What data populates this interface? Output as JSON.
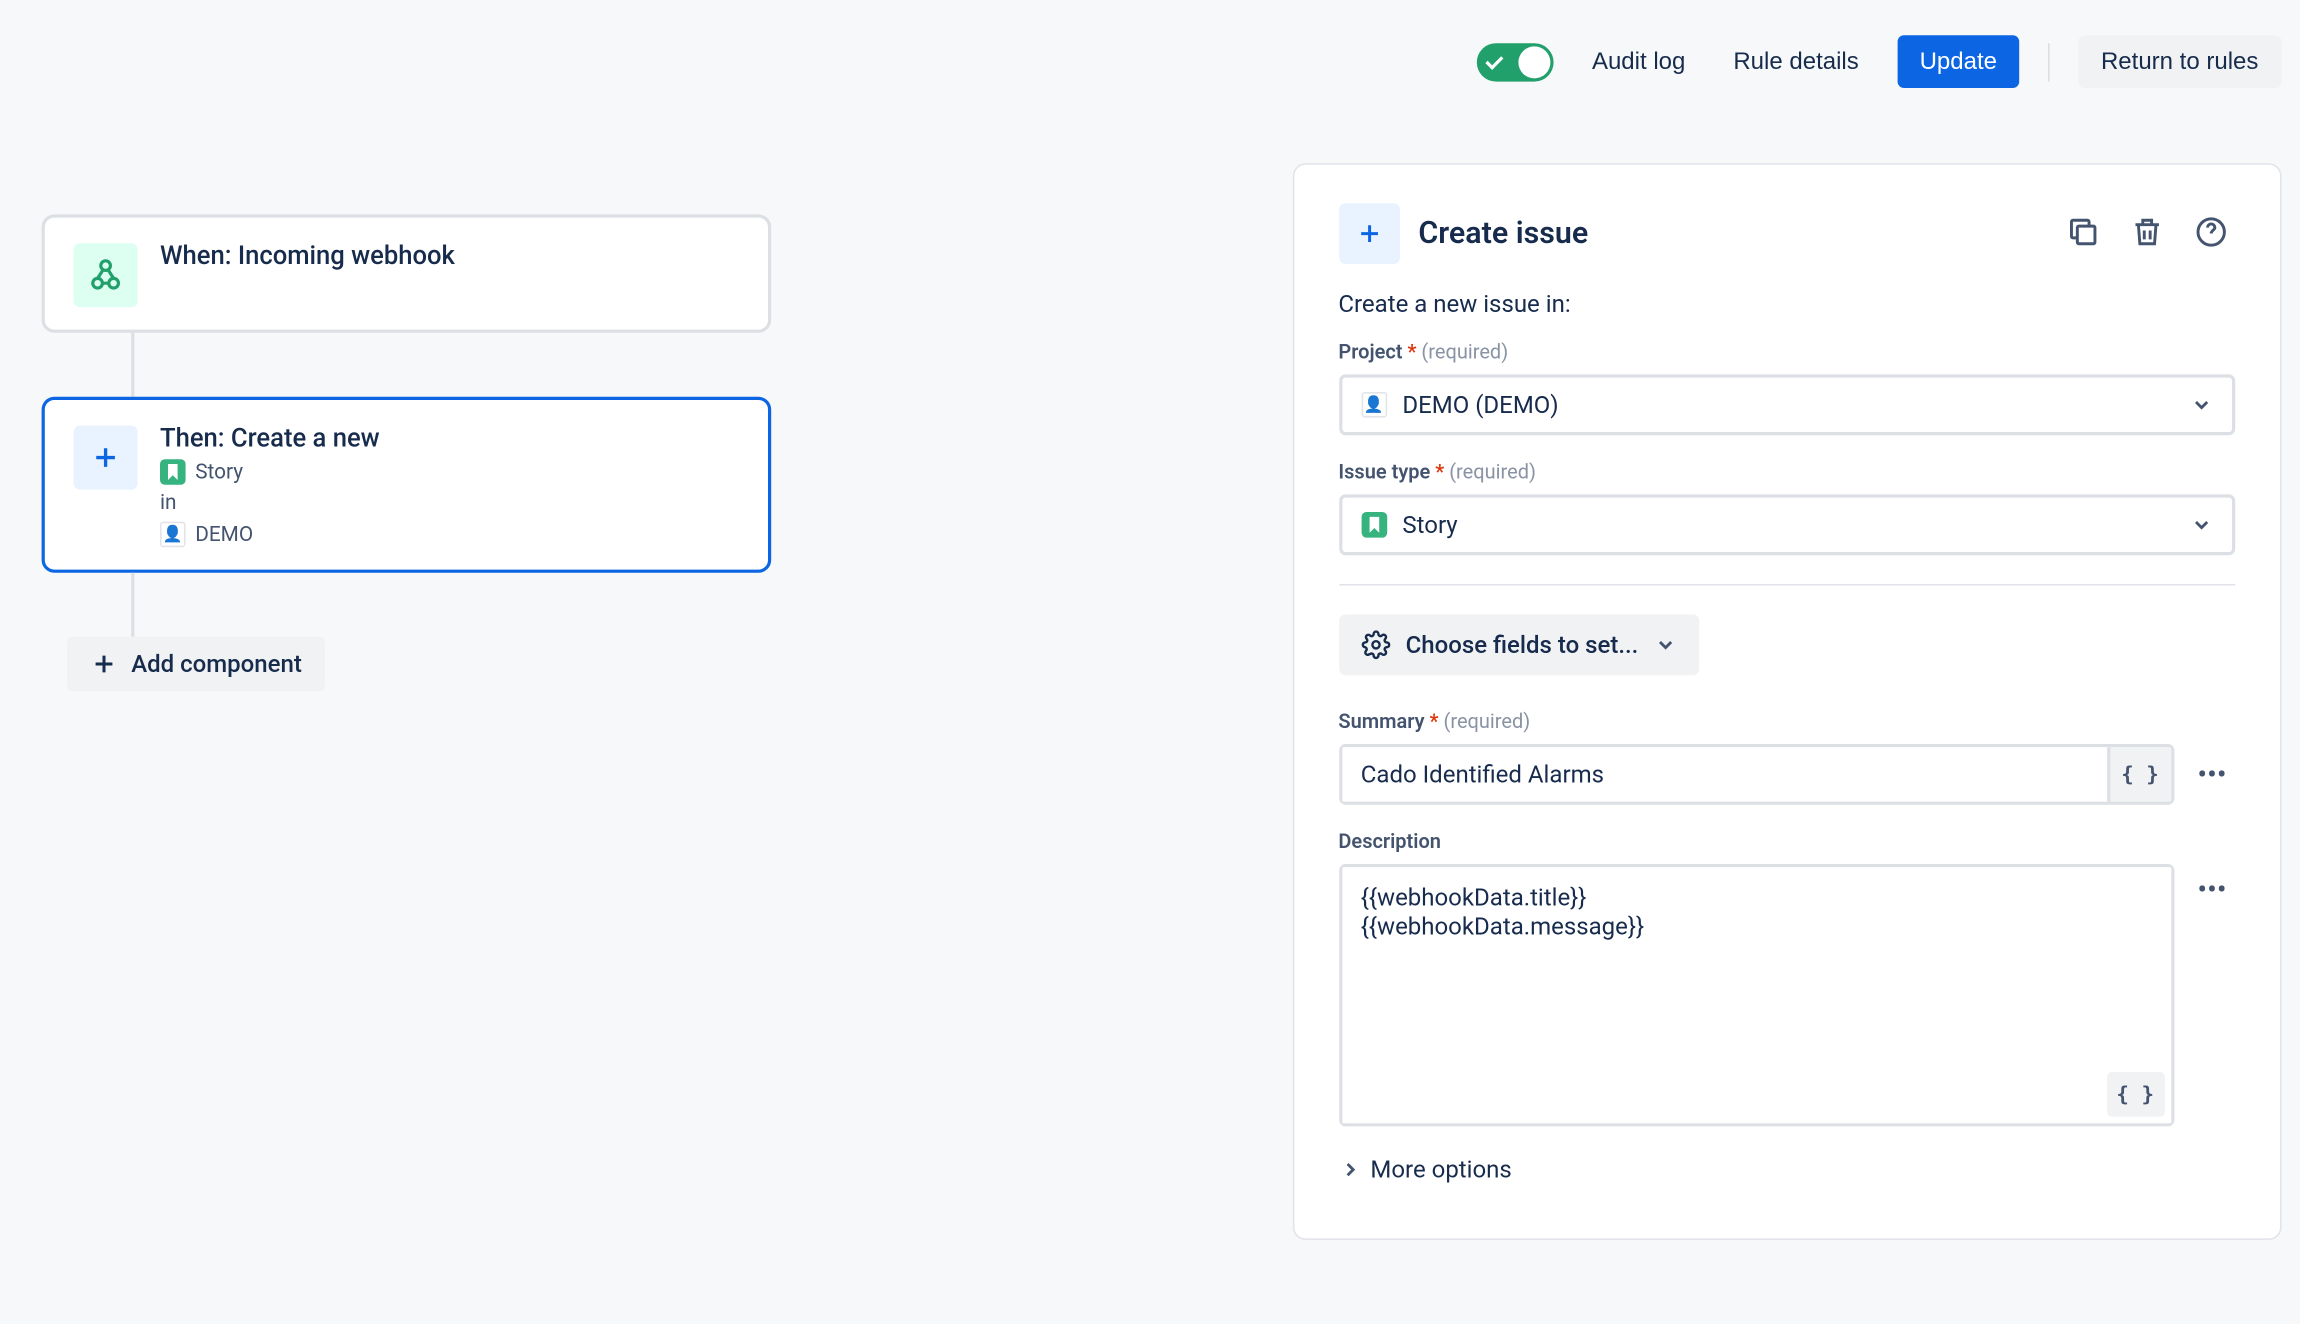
{
  "toolbar": {
    "audit_log": "Audit log",
    "rule_details": "Rule details",
    "update": "Update",
    "return_to_rules": "Return to rules"
  },
  "flow": {
    "trigger": {
      "title": "When: Incoming webhook"
    },
    "action": {
      "title": "Then: Create a new",
      "issuetype": "Story",
      "in_label": "in",
      "project": "DEMO"
    },
    "add_component": "Add component"
  },
  "panel": {
    "title": "Create issue",
    "intro": "Create a new issue in:",
    "project_label": "Project",
    "project_value": "DEMO (DEMO)",
    "issuetype_label": "Issue type",
    "issuetype_value": "Story",
    "required_hint": "(required)",
    "choose_fields": "Choose fields to set...",
    "summary_label": "Summary",
    "summary_value": "Cado Identified Alarms",
    "description_label": "Description",
    "description_value": "{{webhookData.title}}\n{{webhookData.message}}",
    "more_options": "More options"
  }
}
